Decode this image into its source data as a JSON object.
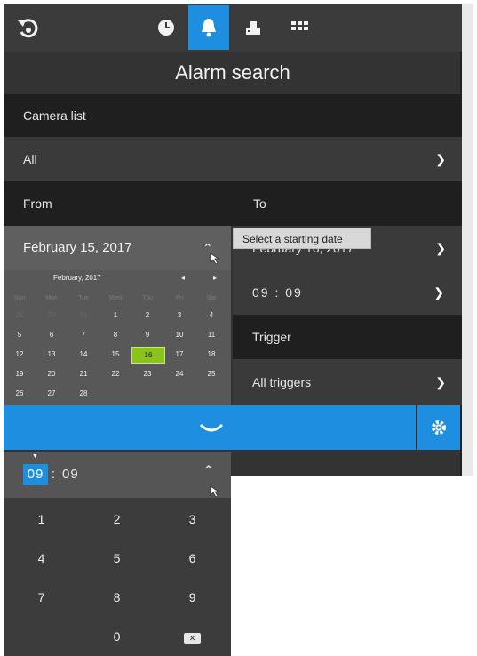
{
  "app": {
    "title": "Alarm search",
    "tabs": [
      {
        "icon": "clock-icon"
      },
      {
        "icon": "bell-icon",
        "active": true
      },
      {
        "icon": "recorder-icon"
      },
      {
        "icon": "grid-icon"
      }
    ],
    "accent": "#1e8fe0"
  },
  "camera": {
    "label": "Camera list",
    "value": "All"
  },
  "range": {
    "from_label": "From",
    "to_label": "To",
    "from_date": "February 15, 2017",
    "to_date": "February 16, 2017",
    "to_time": "09 : 09"
  },
  "tooltip": "Select a starting date",
  "calendar": {
    "month": "February, 2017",
    "prev": "◂",
    "next": "▸",
    "weekdays": [
      "Sun",
      "Mon",
      "Tue",
      "Wed",
      "Thu",
      "Fri",
      "Sat"
    ],
    "weeks": [
      [
        "29",
        "30",
        "31",
        "1",
        "2",
        "3",
        "4"
      ],
      [
        "5",
        "6",
        "7",
        "8",
        "9",
        "10",
        "11"
      ],
      [
        "12",
        "13",
        "14",
        "15",
        "16",
        "17",
        "18"
      ],
      [
        "19",
        "20",
        "21",
        "22",
        "23",
        "24",
        "25"
      ],
      [
        "26",
        "27",
        "28",
        "",
        "",
        "",
        ""
      ]
    ],
    "selected": "16"
  },
  "trigger": {
    "label": "Trigger",
    "value": "All triggers"
  },
  "time_input": {
    "hours": "09",
    "separator": ":",
    "minutes": "09"
  },
  "keypad": {
    "keys": [
      "1",
      "2",
      "3",
      "4",
      "5",
      "6",
      "7",
      "8",
      "9",
      "0"
    ],
    "backspace": "✕"
  }
}
